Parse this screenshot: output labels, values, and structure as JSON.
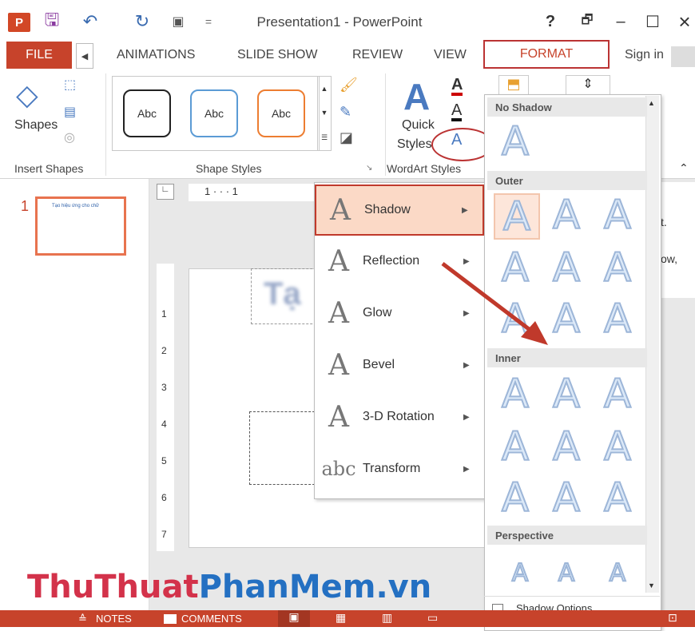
{
  "titlebar": {
    "title": "Presentation1 - PowerPoint",
    "help": "?",
    "restore": "🗗",
    "minimize": "–",
    "maximize": "☐",
    "close": "×"
  },
  "tabs": {
    "file": "FILE",
    "animations": "ANIMATIONS",
    "slideshow": "SLIDE SHOW",
    "review": "REVIEW",
    "view": "VIEW",
    "format": "FORMAT",
    "signin": "Sign in"
  },
  "ribbon": {
    "shapes_label": "Shapes",
    "insert_shapes_label": "Insert Shapes",
    "shape_styles_label": "Shape Styles",
    "wordart_styles_label": "WordArt Styles",
    "quick_label": "Quick",
    "styles_label": "Styles",
    "style_samples": [
      "Abc",
      "Abc",
      "Abc"
    ]
  },
  "slides": {
    "number": "1",
    "thumb_text": "Tạo hiệu ứng cho chữ"
  },
  "editor": {
    "blur_text": "Tạ",
    "ruler_h": "1 · · · 1",
    "ruler_v": [
      "1",
      "2",
      "3",
      "4",
      "5",
      "6",
      "7"
    ],
    "right_pane_lines": [
      "t.",
      "ow,"
    ]
  },
  "effects_menu": {
    "items": [
      {
        "label": "Shadow",
        "icon": "A"
      },
      {
        "label": "Reflection",
        "icon": "A"
      },
      {
        "label": "Glow",
        "icon": "A"
      },
      {
        "label": "Bevel",
        "icon": "A"
      },
      {
        "label": "3-D Rotation",
        "icon": "A"
      },
      {
        "label": "Transform",
        "icon": "abc"
      }
    ]
  },
  "shadow_gallery": {
    "no_shadow": "No Shadow",
    "outer": "Outer",
    "inner": "Inner",
    "perspective": "Perspective",
    "options": "Shadow Options...",
    "glyph": "A"
  },
  "statusbar": {
    "notes": "NOTES",
    "comments": "COMMENTS"
  },
  "watermark": {
    "part1": "ThuThuat",
    "part2": "PhanMem.vn"
  },
  "colors": {
    "accent": "#c7432b",
    "highlight": "#fbd9c6",
    "callout": "#c0392b"
  }
}
